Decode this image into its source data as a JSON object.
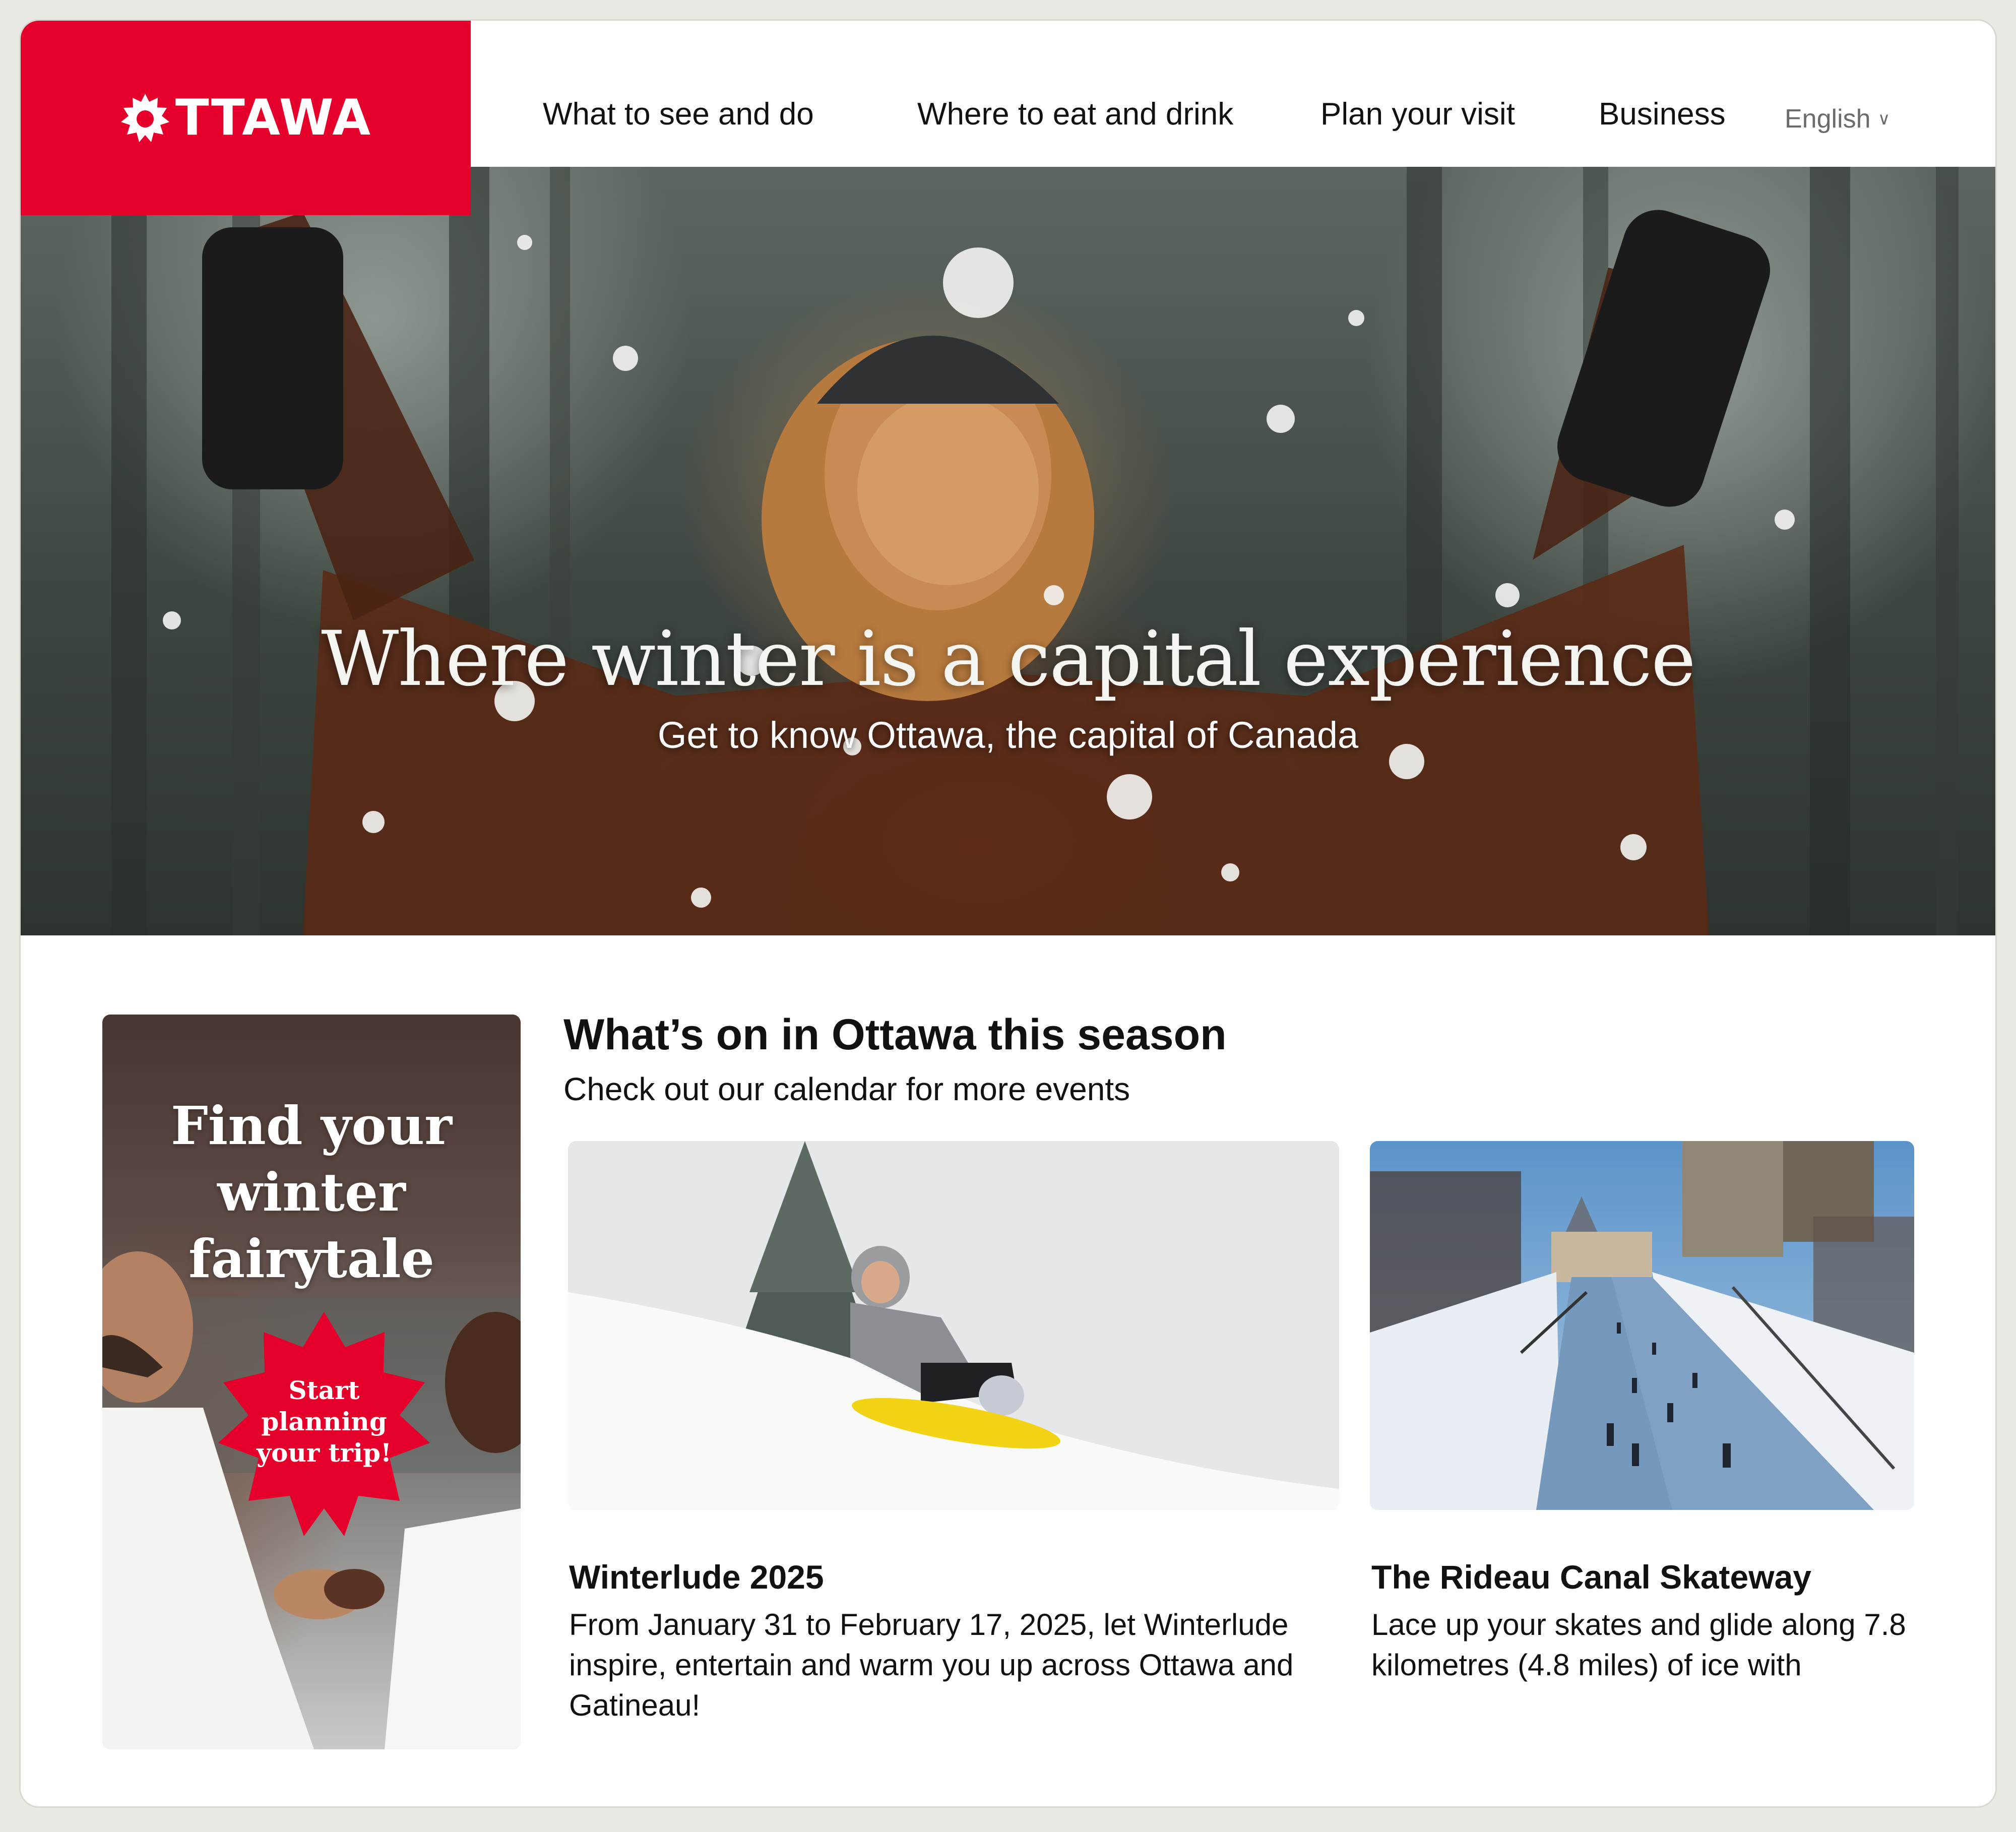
{
  "header": {
    "logo_text": "TTAWA",
    "nav": [
      {
        "label": "What to see and do"
      },
      {
        "label": "Where to eat and drink"
      },
      {
        "label": "Plan your visit"
      },
      {
        "label": "Business"
      }
    ],
    "language": "English"
  },
  "hero": {
    "title": "Where winter is a capital experience",
    "subtitle": "Get to know Ottawa, the capital of Canada"
  },
  "promo": {
    "title_lines": [
      "Find your",
      "winter",
      "fairytale"
    ],
    "cta_lines": [
      "Start",
      "planning",
      "your trip!"
    ]
  },
  "section": {
    "title": "What’s on in Ottawa this season",
    "subtitle": "Check out our calendar for more events"
  },
  "cards": [
    {
      "title": "Winterlude 2025",
      "description_lines": [
        "From January 31 to February 17, 2025, let Winterlude",
        "inspire, entertain and warm you up across Ottawa and",
        "Gatineau!"
      ]
    },
    {
      "title": "The Rideau Canal Skateway",
      "description_lines": [
        "Lace up your skates and glide along 7.8",
        "kilometres (4.8 miles) of ice with"
      ]
    }
  ],
  "colors": {
    "brand_red": "#e4002b",
    "page_background": "#e9e9e3",
    "text": "#111111"
  }
}
